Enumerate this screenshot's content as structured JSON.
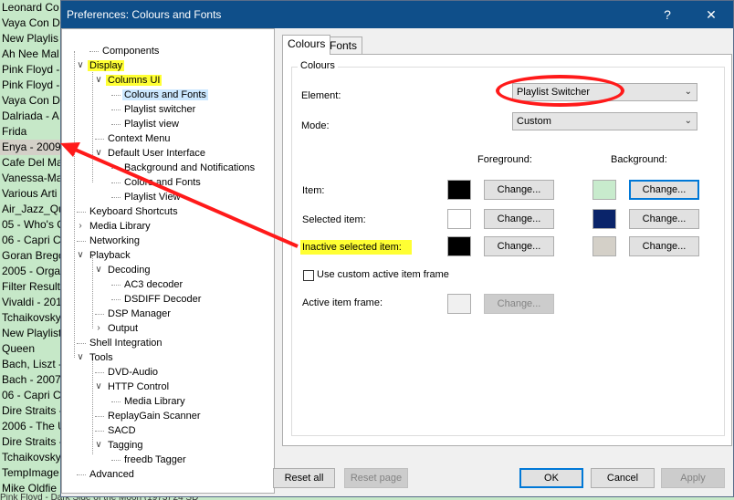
{
  "background_list": {
    "rows": [
      "Leonard Co",
      "Vaya Con D",
      "New Playlis",
      "Ah Nee Mal",
      "Pink Floyd -",
      "Pink Floyd -",
      "Vaya Con D",
      "Dalriada - A",
      "Frida",
      "Enya - 2009",
      "Cafe Del Ma",
      "Vanessa-Ma",
      "Various Arti",
      "Air_Jazz_Qu",
      "05 - Who's C",
      "06 - Capri C",
      "Goran Brego",
      "2005 - Orga",
      "Filter Result",
      "Vivaldi - 201",
      "Tchaikovsky",
      "New Playlist",
      "Queen",
      "Bach, Liszt -",
      "Bach - 2007",
      "06 - Capri C",
      "Dire Straits -",
      "2006 - The U",
      "Dire Straits -",
      "Tchaikovsky",
      "TempImage",
      "Mike Oldfie"
    ],
    "selected_index": 9,
    "bottom_text": "Pink Floyd - Dark Side of the Moon (1973) 24 SD"
  },
  "window": {
    "title": "Preferences: Colours and Fonts",
    "help_glyph": "?",
    "close_glyph": "✕"
  },
  "tree": {
    "items": [
      {
        "label": "Components"
      },
      {
        "label": "Display",
        "twisty": "v"
      },
      {
        "label": "Columns UI",
        "twisty": "v"
      },
      {
        "label": "Colours and Fonts"
      },
      {
        "label": "Playlist switcher"
      },
      {
        "label": "Playlist view"
      },
      {
        "label": "Context Menu"
      },
      {
        "label": "Default User Interface",
        "twisty": "v"
      },
      {
        "label": "Background and Notifications"
      },
      {
        "label": "Colors and Fonts"
      },
      {
        "label": "Playlist View"
      },
      {
        "label": "Keyboard Shortcuts"
      },
      {
        "label": "Media Library",
        "twisty": ">"
      },
      {
        "label": "Networking"
      },
      {
        "label": "Playback",
        "twisty": "v"
      },
      {
        "label": "Decoding",
        "twisty": "v"
      },
      {
        "label": "AC3 decoder"
      },
      {
        "label": "DSDIFF Decoder"
      },
      {
        "label": "DSP Manager"
      },
      {
        "label": "Output",
        "twisty": ">"
      },
      {
        "label": "Shell Integration"
      },
      {
        "label": "Tools",
        "twisty": "v"
      },
      {
        "label": "DVD-Audio"
      },
      {
        "label": "HTTP Control",
        "twisty": "v"
      },
      {
        "label": "Media Library"
      },
      {
        "label": "ReplayGain Scanner"
      },
      {
        "label": "SACD"
      },
      {
        "label": "Tagging",
        "twisty": "v"
      },
      {
        "label": "freedb Tagger"
      },
      {
        "label": "Advanced"
      }
    ]
  },
  "tabs": {
    "colours": "Colours",
    "fonts": "Fonts"
  },
  "colours_group": {
    "label": "Colours",
    "element_label": "Element:",
    "element_value": "Playlist Switcher",
    "mode_label": "Mode:",
    "mode_value": "Custom",
    "foreground_header": "Foreground:",
    "background_header": "Background:",
    "rows": [
      {
        "label": "Item:",
        "fg_color": "#000000",
        "bg_color": "#c8ebcd",
        "fg_button": "Change...",
        "bg_button": "Change..."
      },
      {
        "label": "Selected item:",
        "fg_color": "#ffffff",
        "bg_color": "#0a246a",
        "fg_button": "Change...",
        "bg_button": "Change..."
      },
      {
        "label": "Inactive selected item:",
        "fg_color": "#000000",
        "bg_color": "#d4d0c8",
        "fg_button": "Change...",
        "bg_button": "Change..."
      }
    ],
    "custom_frame_checkbox": {
      "label": "Use custom active item frame",
      "checked": false
    },
    "active_frame_label": "Active item frame:",
    "active_frame_color": "#f0f0f0",
    "active_frame_button": "Change..."
  },
  "footer": {
    "reset_all": "Reset all",
    "reset_page": "Reset page",
    "ok": "OK",
    "cancel": "Cancel",
    "apply": "Apply"
  },
  "colors": {
    "titlebar": "#0f4f8a",
    "highlight_yellow": "#ffff33",
    "annotation_red": "#ff1a1a",
    "selection_blue": "#cce8ff",
    "focus_blue": "#0078d7"
  }
}
